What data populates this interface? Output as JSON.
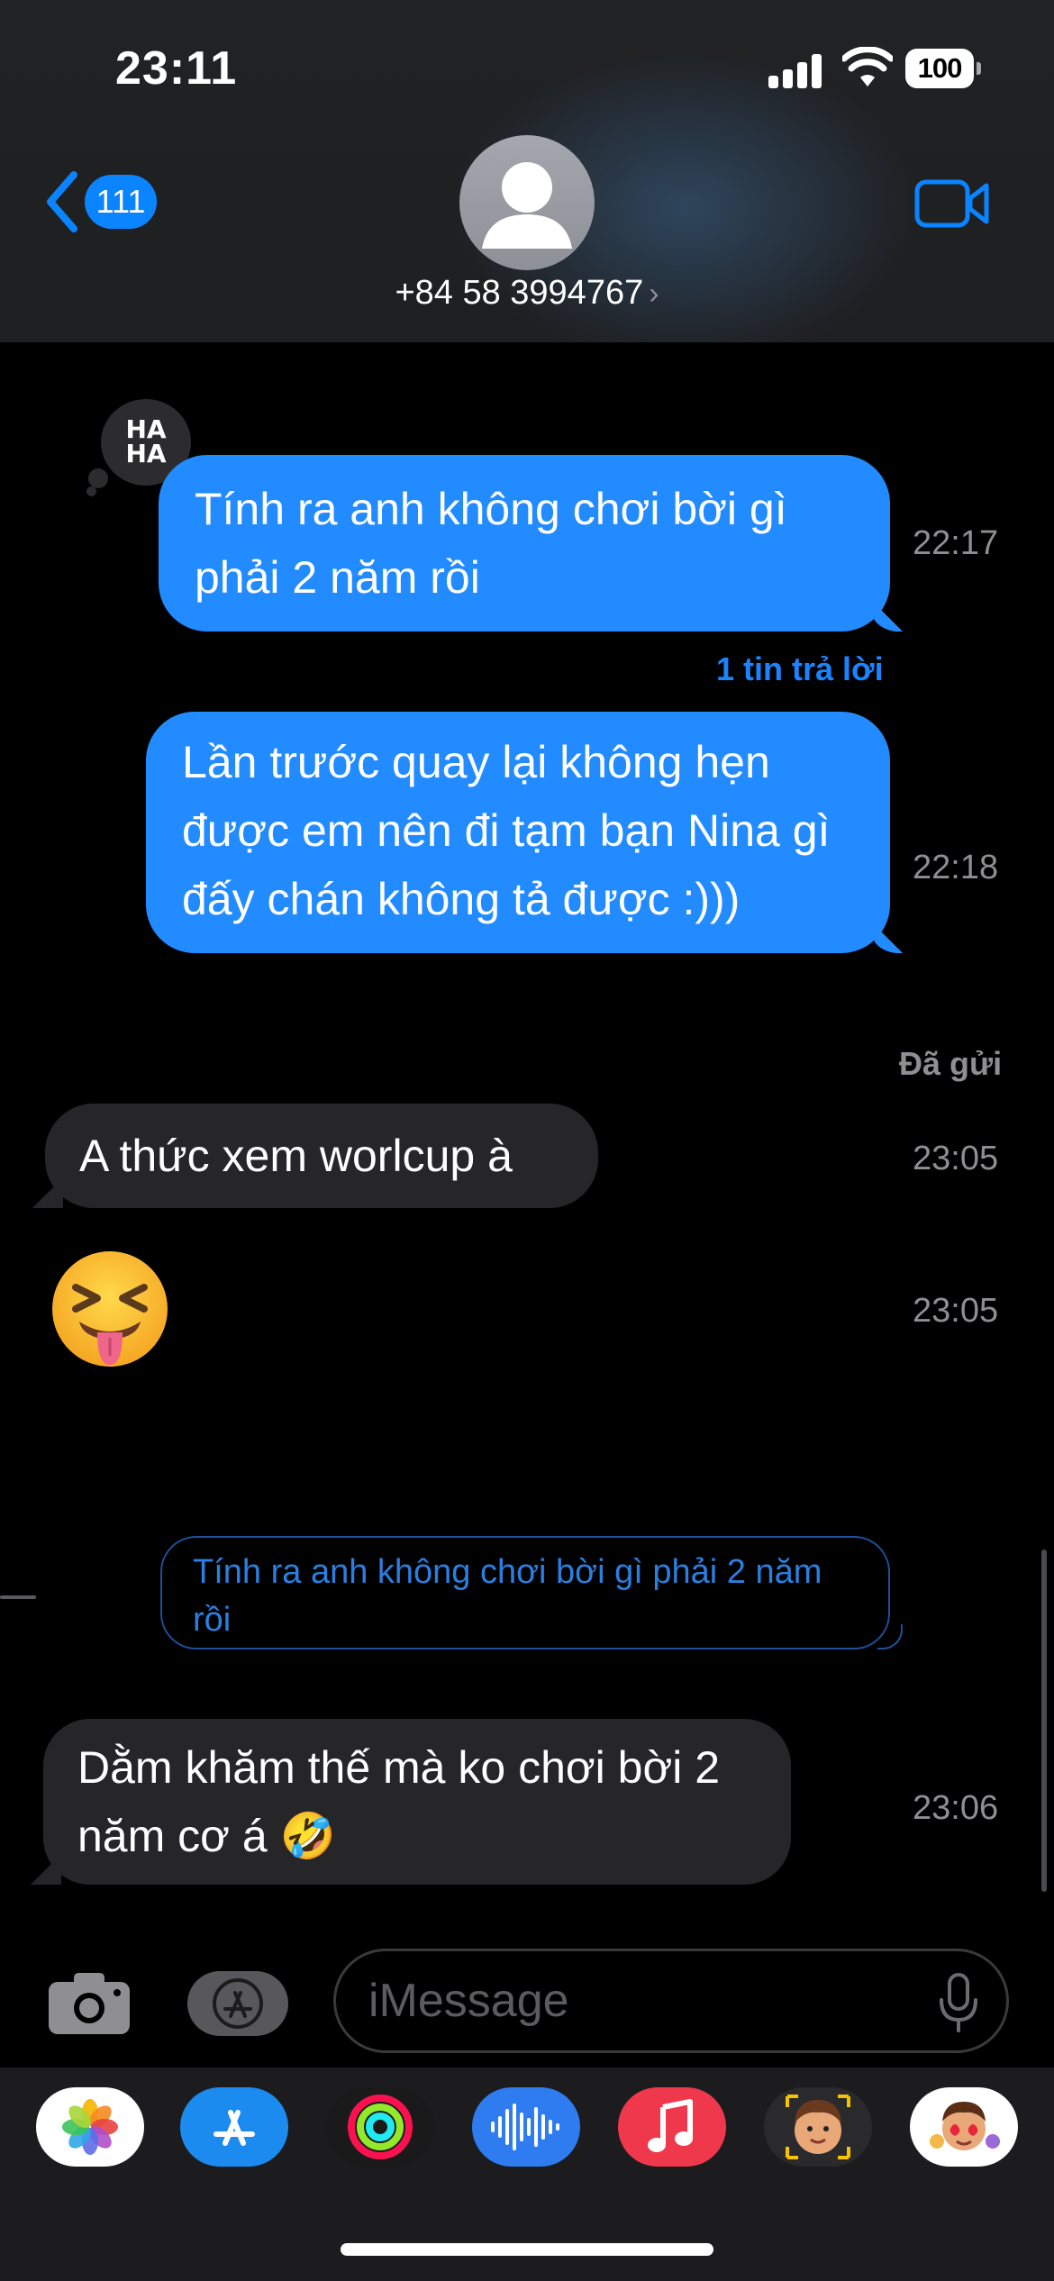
{
  "status_bar": {
    "time": "23:11",
    "battery": "100"
  },
  "header": {
    "back_count": "111",
    "contact_number": "+84 58 3994767",
    "chevron": "›"
  },
  "messages": [
    {
      "side": "out",
      "text": "Tính ra anh không chơi bời gì phải 2 năm rồi",
      "time": "22:17",
      "reaction": "haha"
    },
    {
      "side": "out",
      "text": "Lần trước quay lại không hẹn được em nên đi tạm bạn Nina gì đấy chán không tả được :)))",
      "time": "22:18"
    },
    {
      "side": "in",
      "text": "A thức xem worlcup à",
      "time": "23:05"
    },
    {
      "side": "in",
      "emoji": "😝",
      "time": "23:05"
    },
    {
      "side": "in",
      "text": "Dằm khăm thế mà ko chơi bời 2 năm cơ á 🤣",
      "time": "23:06"
    }
  ],
  "reaction_label": {
    "line1": "HA",
    "line2": "HA"
  },
  "reply_count_label": "1 tin trả lời",
  "delivered_label": "Đã gửi",
  "reply_preview": "Tính ra anh không chơi bời gì phải 2 năm rồi",
  "input": {
    "placeholder": "iMessage"
  },
  "app_drawer": [
    {
      "name": "photos-app",
      "bg": "#ffffff"
    },
    {
      "name": "app-store-app",
      "bg": "#1c8bf0"
    },
    {
      "name": "activity-app",
      "bg": "#1a1a1a"
    },
    {
      "name": "voice-memos-app",
      "bg": "#2f7cf0"
    },
    {
      "name": "music-app",
      "bg": "#f0384c"
    },
    {
      "name": "memoji-app",
      "bg": "#2a2a2c"
    },
    {
      "name": "memoji-stickers-app",
      "bg": "#ffffff"
    }
  ],
  "colors": {
    "accent": "#0a84ff",
    "outgoing": "#218bff",
    "incoming": "#262628"
  }
}
